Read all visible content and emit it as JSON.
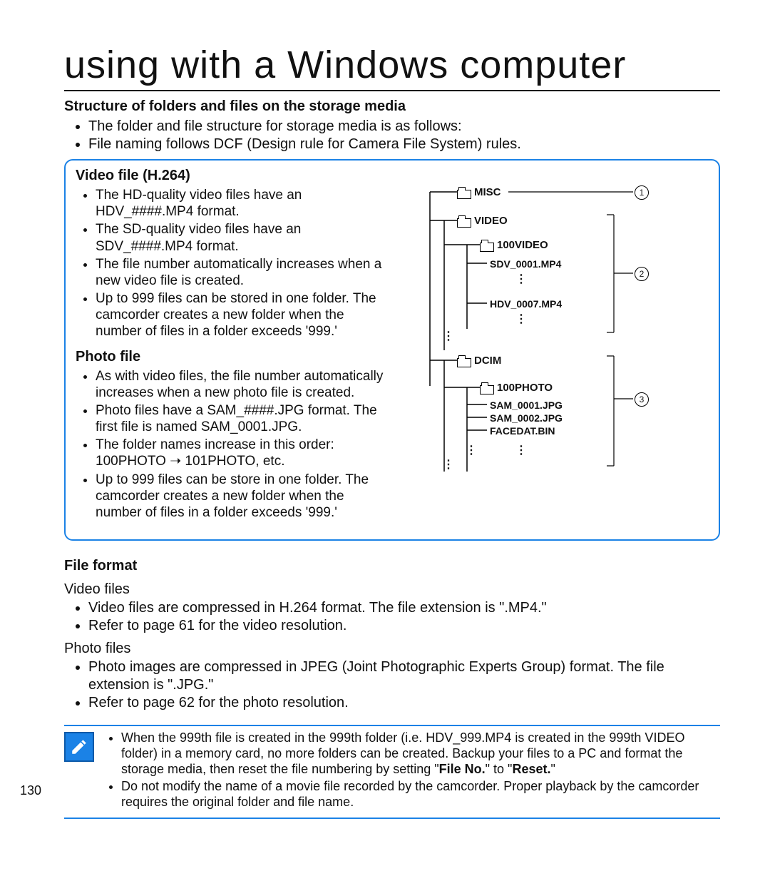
{
  "page_number": "130",
  "title": "using with a Windows computer",
  "structure": {
    "heading": "Structure of folders and files on the storage media",
    "bullets": [
      "The folder and file structure for storage media is as follows:",
      "File naming follows DCF (Design rule for Camera File System) rules."
    ]
  },
  "video_section": {
    "heading": "Video file (H.264)",
    "bullets": [
      "The HD-quality video files have an HDV_####.MP4 format.",
      "The SD-quality video files have an SDV_####.MP4 format.",
      "The file number automatically increases when a new video file is created.",
      "Up to 999 files can be stored in one folder. The camcorder creates a new folder when the number of files in a folder exceeds '999.'"
    ]
  },
  "photo_section": {
    "heading": "Photo file",
    "bullets": [
      "As with video files, the file number automatically increases when a new photo file is created.",
      "Photo files have a SAM_####.JPG format. The first file is named SAM_0001.JPG.",
      "The folder names increase in this order: 100PHOTO ➝ 101PHOTO, etc.",
      "Up to 999 files can be store in one folder. The camcorder creates a new folder when the number of files in a folder exceeds '999.'"
    ]
  },
  "file_format": {
    "heading": "File format",
    "video_sub": "Video files",
    "video_bullets": [
      "Video files are compressed in H.264 format. The file extension is \".MP4.\"",
      "Refer to page 61 for the video resolution."
    ],
    "photo_sub": "Photo files",
    "photo_bullets": [
      "Photo images are compressed in JPEG (Joint Photographic Experts Group) format. The file extension is \".JPG.\"",
      "Refer to page 62 for the photo resolution."
    ]
  },
  "notes": {
    "items": [
      {
        "prefix": "When the 999th file is created in the 999th folder (i.e. HDV_999.MP4 is created in the 999th VIDEO folder) in a memory card, no more folders can be created. Backup your files to a PC and format the storage media, then reset the file numbering by setting \"",
        "b1": "File No.",
        "mid": "\" to \"",
        "b2": "Reset.",
        "suffix": "\""
      },
      {
        "text": "Do not modify the name of a movie file recorded by the camcorder. Proper playback by the camcorder requires the original folder and file name."
      }
    ]
  },
  "tree": {
    "misc": "MISC",
    "video": "VIDEO",
    "video_sub": "100VIDEO",
    "sdv": "SDV_0001.MP4",
    "hdv": "HDV_0007.MP4",
    "dcim": "DCIM",
    "photo_sub": "100PHOTO",
    "sam1": "SAM_0001.JPG",
    "sam2": "SAM_0002.JPG",
    "facedat": "FACEDAT.BIN",
    "c1": "1",
    "c2": "2",
    "c3": "3"
  }
}
